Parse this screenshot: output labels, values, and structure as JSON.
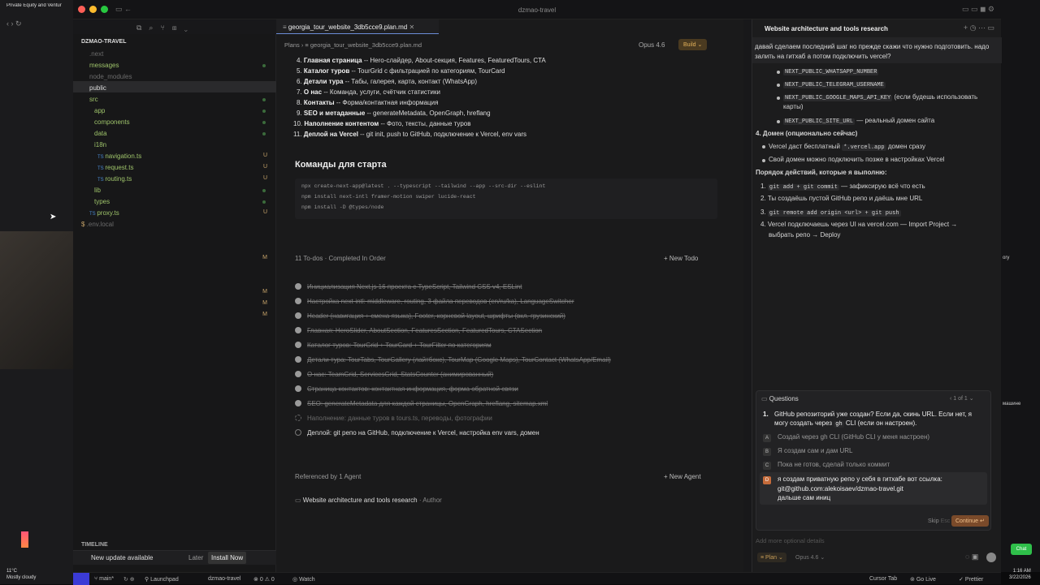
{
  "browser": {
    "tab_title": "Private Equity and Ventur"
  },
  "window": {
    "title": "dzmao-travel"
  },
  "sidebar": {
    "project": "DZMAO-TRAVEL",
    "items": [
      ".next",
      "messages",
      "node_modules",
      "public",
      "src",
      "app",
      "components",
      "data",
      "i18n",
      "navigation.ts",
      "request.ts",
      "routing.ts",
      "lib",
      "types",
      "proxy.ts",
      ".env.local"
    ],
    "badges": [
      "U",
      "U",
      "U",
      "U",
      "M",
      "M",
      "M",
      "M"
    ],
    "timeline": "TIMELINE",
    "update_text": "New update available",
    "later": "Later",
    "install": "Install Now"
  },
  "editor": {
    "tab": "georgia_tour_website_3db5cce9.plan.md",
    "breadcrumb_root": "Plans",
    "breadcrumb_file": "georgia_tour_website_3db5cce9.plan.md",
    "model": "Opus 4.6",
    "build": "Build",
    "plan": [
      {
        "n": "4.",
        "b": "Главная страница",
        "t": " -- Hero-слайдер, About-секция, Features, FeaturedTours, CTA"
      },
      {
        "n": "5.",
        "b": "Каталог туров",
        "t": " -- TourGrid с фильтрацией по категориям, TourCard"
      },
      {
        "n": "6.",
        "b": "Детали тура",
        "t": " -- Табы, галерея, карта, контакт (WhatsApp)"
      },
      {
        "n": "7.",
        "b": "О нас",
        "t": " -- Команда, услуги, счётчик статистики"
      },
      {
        "n": "8.",
        "b": "Контакты",
        "t": " -- Форма/контактная информация"
      },
      {
        "n": "9.",
        "b": "SEO и метаданные",
        "t": " -- generateMetadata, OpenGraph, hreflang"
      },
      {
        "n": "10.",
        "b": "Наполнение контентом",
        "t": " -- Фото, тексты, данные туров"
      },
      {
        "n": "11.",
        "b": "Деплой на Vercel",
        "t": " -- git init, push to GitHub, подключение к Vercel, env vars"
      }
    ],
    "commands_title": "Команды для старта",
    "cmd1": "npx create-next-app@latest . --typescript --tailwind --app --src-dir --eslint",
    "cmd2": "npm install next-intl framer-motion swiper lucide-react",
    "cmd3": "npm install -D @types/node",
    "todos_header": "11 To-dos · Completed In Order",
    "new_todo": "New Todo",
    "todos": [
      "Инициализация Next.js 16 проекта с TypeScript, Tailwind CSS v4, ESLint",
      "Настройка next-intl: middleware, routing, 3 файла переводов (en/ru/ka), LanguageSwitcher",
      "Header (навигация + смена языка), Footer, корневой layout, шрифты (вкл. грузинский)",
      "Главная: HeroSlider, AboutSection, FeaturesSection, FeaturedTours, CTASection",
      "Каталог туров: TourGrid + TourCard + TourFilter по категориям",
      "Детали тура: TourTabs, TourGallery (лайтбокс), TourMap (Google Maps), TourContact (WhatsApp/Email)",
      "О нас: TeamGrid, ServicesGrid, StatsCounter (анимированный)",
      "Страница контактов: контактная информация, форма обратной связи",
      "SEO: generateMetadata для каждой страницы, OpenGraph, hreflang, sitemap.xml",
      "Наполнение: данные туров в tours.ts, переводы, фотографии",
      "Деплой: git репо на GitHub, подключение к Vercel, настройка env vars, домен"
    ],
    "referenced": "Referenced by 1 Agent",
    "new_agent": "New Agent",
    "agent_name": "Website architecture and tools research",
    "agent_role": "· Author"
  },
  "chat": {
    "title": "Website architecture and tools research",
    "user_msg": "давай сделаем последний шаг но прежде скажи что нужно подготовить. надо залить на гитхаб а потом подключить vercel?",
    "env1": "NEXT_PUBLIC_WHATSAPP_NUMBER",
    "env2": "NEXT_PUBLIC_TELEGRAM_USERNAME",
    "env3": "NEXT_PUBLIC_GOOGLE_MAPS_API_KEY",
    "env3b": "(если будешь использовать",
    "env3c": "карты)",
    "env4": "NEXT_PUBLIC_SITE_URL",
    "env4b": "— реальный домен сайта",
    "domain_title": "4. Домен (опционально сейчас)",
    "d1a": "Vercel даст бесплатный",
    "d1code": "*.vercel.app",
    "d1b": "домен сразу",
    "d2": "Свой домен можно подключить позже в настройках Vercel",
    "order_title": "Порядок действий, которые я выполню:",
    "s1code": "git add + git commit",
    "s1": "— зафиксирую всё что есть",
    "s2": "2. Ты создаёшь пустой GitHub репо и даёшь мне URL",
    "s3code": "git remote add origin <url> + git push",
    "s4a": "4. Vercel подключаешь через UI на vercel.com — Import Project →",
    "s4b": "выбрать репо → Deploy",
    "questions": "Questions",
    "q_count": "1 of 1",
    "q_text1": "GitHub репозиторий уже создан? Если да, скинь URL. Если нет, я",
    "q_text2": "могу создать через",
    "q_code": "gh",
    "q_text3": "CLI (если он настроен).",
    "options": [
      {
        "k": "A",
        "t": "Создай через gh CLI (GitHub CLI у меня настроен)"
      },
      {
        "k": "B",
        "t": "Я создам сам и дам URL"
      },
      {
        "k": "C",
        "t": "Пока не готов, сделай только коммит"
      }
    ],
    "answer_key": "D",
    "answer1": "я создам приватную репо у себя в гитхабе вот ссылка:",
    "answer2": "git@github.com:alekoisaev/dzmao-travel.git",
    "answer3": "дальше сам иниц",
    "skip": "Skip",
    "esc": "Esc",
    "continue": "Continue",
    "placeholder": "Add more optional details",
    "mode": "Plan",
    "model": "Opus 4.6",
    "chat_btn": "Chat"
  },
  "status": {
    "branch": "main*",
    "launchpad": "Launchpad",
    "project": "dzmao-travel",
    "errors": "0",
    "warnings": "0",
    "watch": "Watch",
    "cursor_tab": "Cursor Tab",
    "golive": "Go Live",
    "prettier": "Prettier"
  },
  "taskbar": {
    "temp": "11°C",
    "weather": "Mostly cloudy",
    "time": "1:16 AM",
    "date": "3/22/2026"
  },
  "edge": {
    "r1": "ory",
    "r2": "машине"
  }
}
